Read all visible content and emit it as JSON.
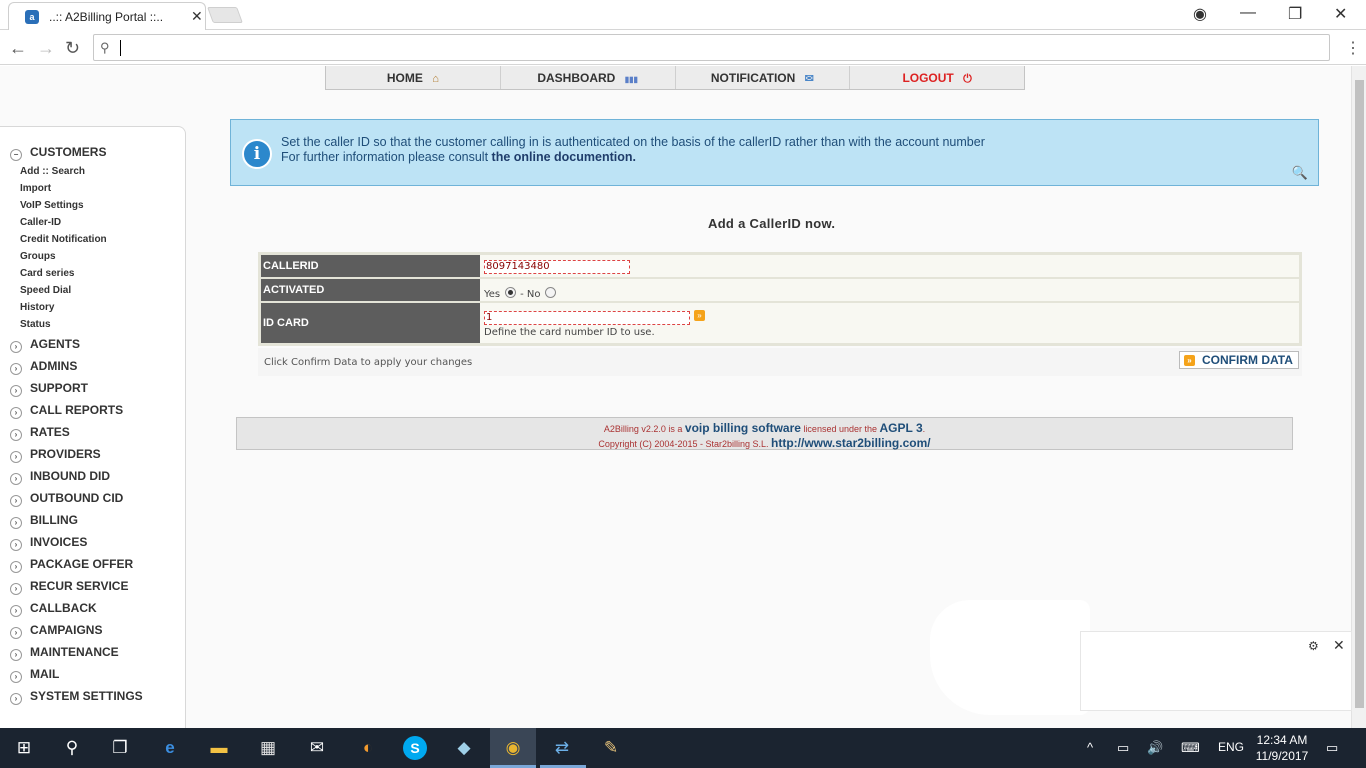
{
  "browser": {
    "tab_title": "..:: A2Billing Portal ::..",
    "tab_close": "✕",
    "window_controls": {
      "account": "◉",
      "minimize": "—",
      "maximize": "❐",
      "close": "✕"
    },
    "nav": {
      "back": "←",
      "forward": "→",
      "reload": "↻"
    },
    "address_value": "",
    "menu": "⋮",
    "search_glyph": "⚲"
  },
  "topnav": {
    "items": [
      {
        "label": "HOME",
        "icon": "home-icon",
        "glyph": "⌂"
      },
      {
        "label": "DASHBOARD",
        "icon": "dashboard-icon",
        "glyph": "▮▮▮"
      },
      {
        "label": "NOTIFICATION",
        "icon": "mail-icon",
        "glyph": "✉"
      },
      {
        "label": "LOGOUT",
        "icon": "power-icon",
        "glyph": "⏻"
      }
    ]
  },
  "sidebar": {
    "open_section": "CUSTOMERS",
    "open_toggle": "−",
    "closed_toggle": "›",
    "sub_items": [
      "Add :: Search",
      "Import",
      "VoIP Settings",
      "Caller-ID",
      "Credit Notification",
      "Groups",
      "Card series",
      "Speed Dial",
      "History",
      "Status"
    ],
    "sections": [
      "AGENTS",
      "ADMINS",
      "SUPPORT",
      "CALL REPORTS",
      "RATES",
      "PROVIDERS",
      "INBOUND DID",
      "OUTBOUND CID",
      "BILLING",
      "INVOICES",
      "PACKAGE OFFER",
      "RECUR SERVICE",
      "CALLBACK",
      "CAMPAIGNS",
      "MAINTENANCE",
      "MAIL",
      "SYSTEM SETTINGS"
    ]
  },
  "info": {
    "icon_glyph": "i",
    "line1": "Set the caller ID so that the customer calling in is authenticated on the basis of the callerID rather than with the account number",
    "line2_prefix": "For further information please consult",
    "line2_link": "the online documention.",
    "zoom_glyph": "🔍"
  },
  "form": {
    "heading": "Add a CallerID now.",
    "callerid_label": "CALLERID",
    "callerid_value": "8097143480",
    "activated_label": "ACTIVATED",
    "yes_label": "Yes",
    "no_label": "- No",
    "activated": "yes",
    "idcard_label": "ID CARD",
    "idcard_value": "1",
    "idcard_help": "Define the card number ID to use.",
    "idcard_btn_glyph": "»",
    "footer_hint": "Click Confirm Data to apply your changes",
    "confirm_label": "CONFIRM DATA",
    "confirm_glyph": "»"
  },
  "copyright": {
    "line1_a": "A2Billing v2.2.0 is a",
    "line1_link": "voip billing software",
    "line1_b": "licensed under the",
    "line1_license": "AGPL 3",
    "line1_end": ".",
    "line2_a": "Copyright (C) 2004-2015 - Star2billing S.L.",
    "line2_link": "http://www.star2billing.com/"
  },
  "notification": {
    "gear": "⚙",
    "close": "✕"
  },
  "taskbar": {
    "start": "⊞",
    "search": "⚲",
    "taskview": "❐",
    "apps": [
      {
        "name": "edge-icon",
        "glyph": "e"
      },
      {
        "name": "file-explorer-icon",
        "glyph": "▬"
      },
      {
        "name": "store-icon",
        "glyph": "▦"
      },
      {
        "name": "mail-app-icon",
        "glyph": "✉"
      },
      {
        "name": "app-swirl-icon",
        "glyph": "◐"
      },
      {
        "name": "skype-icon",
        "glyph": "S"
      },
      {
        "name": "notes-app-icon",
        "glyph": "◆"
      },
      {
        "name": "chrome-icon",
        "glyph": "◉"
      },
      {
        "name": "network-app-icon",
        "glyph": "⇄"
      },
      {
        "name": "paint-icon",
        "glyph": "✎"
      }
    ],
    "tray": {
      "chevron": "^",
      "battery": "▭",
      "volume": "🔊",
      "keyboard": "⌨",
      "lang": "ENG",
      "notifications": "▭"
    },
    "time": "12:34 AM",
    "date": "11/9/2017"
  }
}
